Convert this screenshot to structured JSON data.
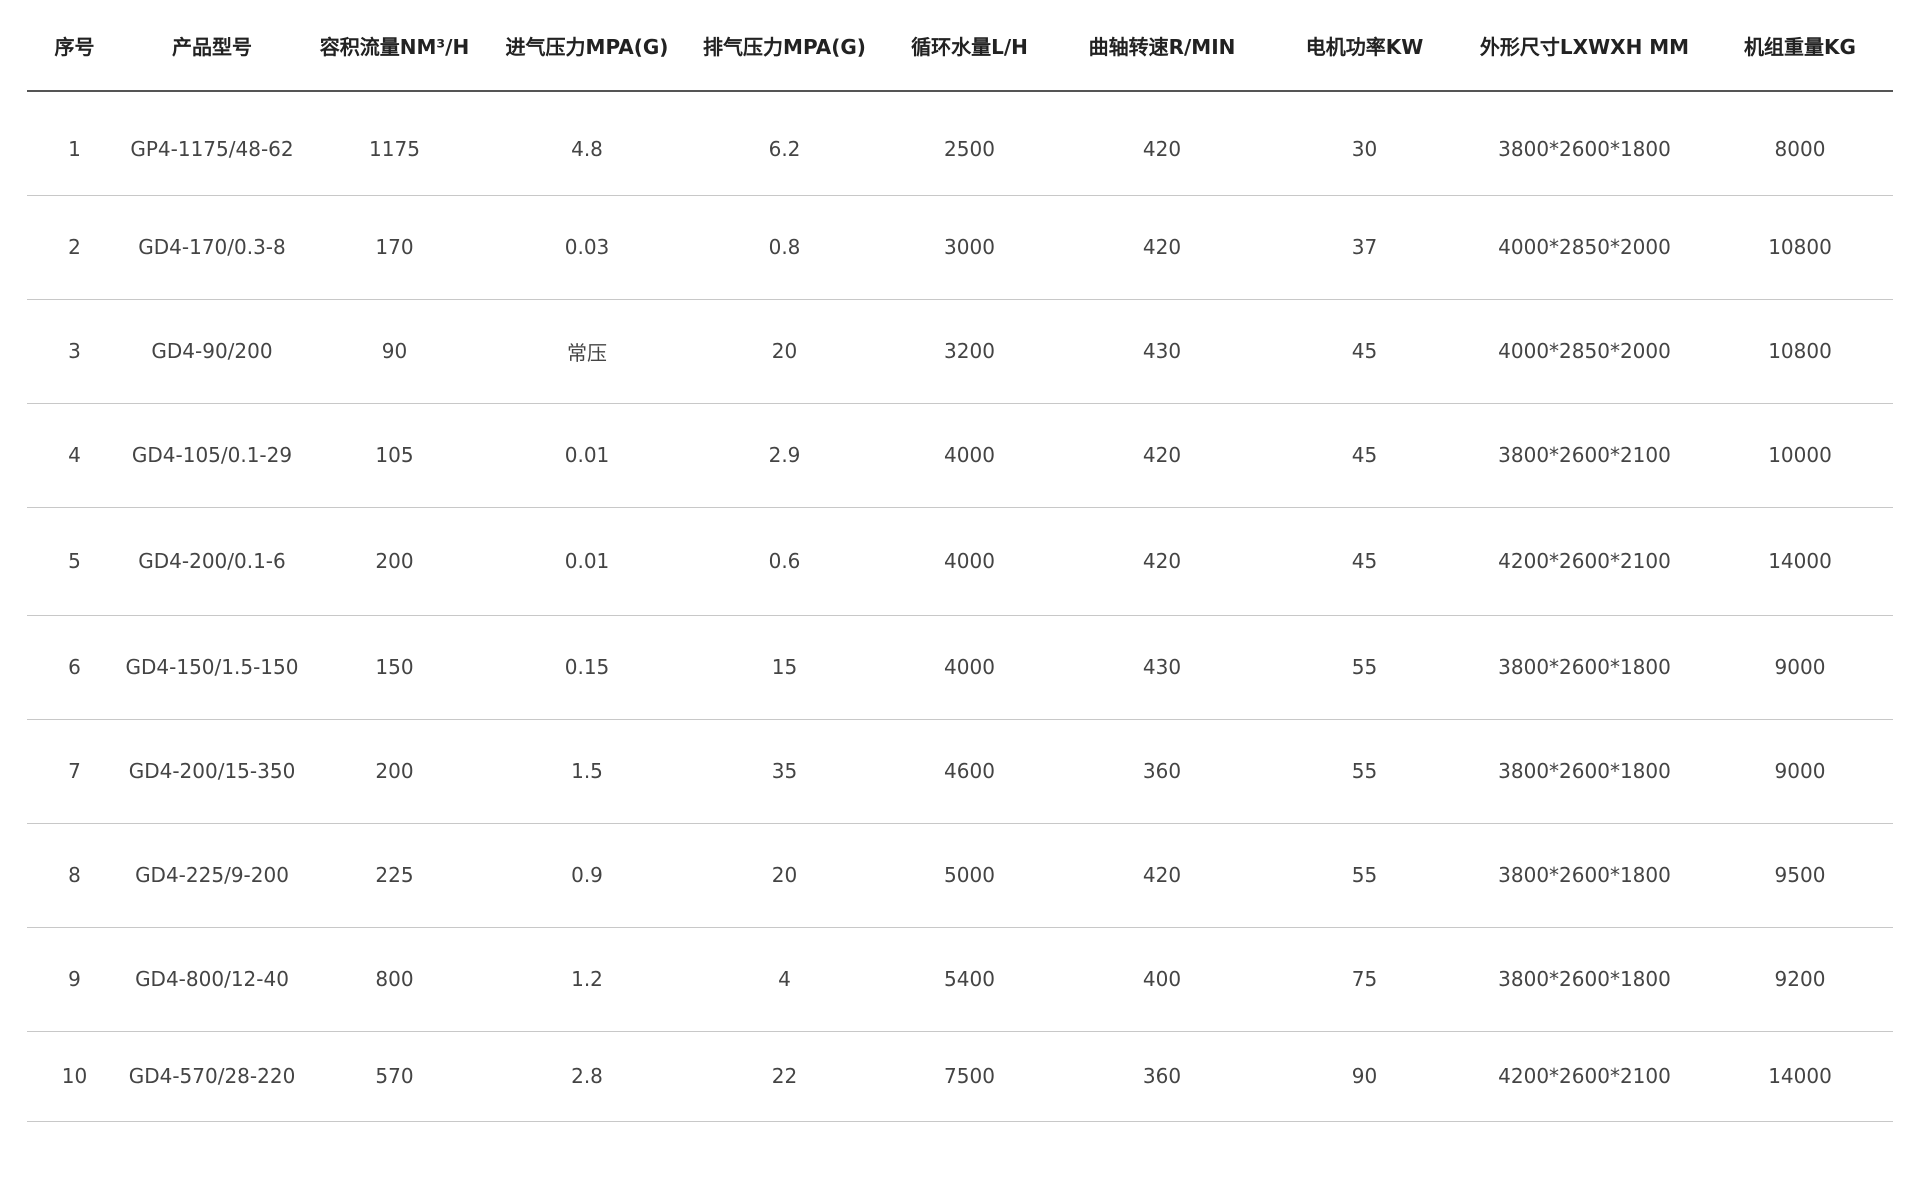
{
  "table": {
    "headers": [
      "序号",
      "产品型号",
      "容积流量NM³/H",
      "进气压力MPA(G)",
      "排气压力MPA(G)",
      "循环水量L/H",
      "曲轴转速R/MIN",
      "电机功率KW",
      "外形尺寸LXWXH MM",
      "机组重量KG"
    ],
    "rows": [
      [
        "1",
        "GP4-1175/48-62",
        "1175",
        "4.8",
        "6.2",
        "2500",
        "420",
        "30",
        "3800*2600*1800",
        "8000"
      ],
      [
        "2",
        "GD4-170/0.3-8",
        "170",
        "0.03",
        "0.8",
        "3000",
        "420",
        "37",
        "4000*2850*2000",
        "10800"
      ],
      [
        "3",
        "GD4-90/200",
        "90",
        "常压",
        "20",
        "3200",
        "430",
        "45",
        "4000*2850*2000",
        "10800"
      ],
      [
        "4",
        "GD4-105/0.1-29",
        "105",
        "0.01",
        "2.9",
        "4000",
        "420",
        "45",
        "3800*2600*2100",
        "10000"
      ],
      [
        "5",
        "GD4-200/0.1-6",
        "200",
        "0.01",
        "0.6",
        "4000",
        "420",
        "45",
        "4200*2600*2100",
        "14000"
      ],
      [
        "6",
        "GD4-150/1.5-150",
        "150",
        "0.15",
        "15",
        "4000",
        "430",
        "55",
        "3800*2600*1800",
        "9000"
      ],
      [
        "7",
        "GD4-200/15-350",
        "200",
        "1.5",
        "35",
        "4600",
        "360",
        "55",
        "3800*2600*1800",
        "9000"
      ],
      [
        "8",
        "GD4-225/9-200",
        "225",
        "0.9",
        "20",
        "5000",
        "420",
        "55",
        "3800*2600*1800",
        "9500"
      ],
      [
        "9",
        "GD4-800/12-40",
        "800",
        "1.2",
        "4",
        "5400",
        "400",
        "75",
        "3800*2600*1800",
        "9200"
      ],
      [
        "10",
        "GD4-570/28-220",
        "570",
        "2.8",
        "22",
        "7500",
        "360",
        "90",
        "4200*2600*2100",
        "14000"
      ]
    ]
  }
}
